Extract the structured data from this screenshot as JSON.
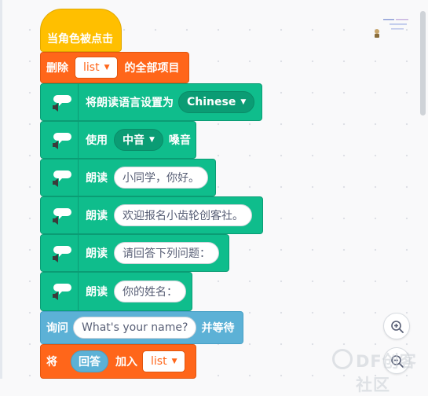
{
  "hat_block": {
    "label": "当角色被点击"
  },
  "delete_block": {
    "prefix": "删除",
    "list_name": "list",
    "suffix": "的全部项目"
  },
  "language_block": {
    "label": "将朗读语言设置为",
    "value": "Chinese"
  },
  "voice_block": {
    "prefix": "使用",
    "value": "中音",
    "suffix": "嗓音"
  },
  "speak_blocks": [
    {
      "label": "朗读",
      "text": "小同学，你好。"
    },
    {
      "label": "朗读",
      "text": "欢迎报名小齿轮创客社。"
    },
    {
      "label": "朗读",
      "text": "请回答下列问题："
    },
    {
      "label": "朗读",
      "text": "你的姓名："
    }
  ],
  "ask_block": {
    "prefix": "询问",
    "question": "What's your name?",
    "suffix": "并等待"
  },
  "add_block": {
    "prefix": "将",
    "reporter": "回答",
    "middle": "加入",
    "list_name": "list"
  },
  "watermark": {
    "text": "DF创客社区"
  },
  "colors": {
    "events": "#ffbf00",
    "data_list": "#ff661a",
    "text2speech": "#0fbd8c",
    "sensing": "#5cb1d6",
    "background": "#f9f9fa"
  },
  "icons": {
    "speech": "speech-bubble-speaker-icon",
    "zoom_in": "zoom-in-icon",
    "zoom_out": "zoom-out-icon",
    "dropdown": "caret-down-icon"
  }
}
